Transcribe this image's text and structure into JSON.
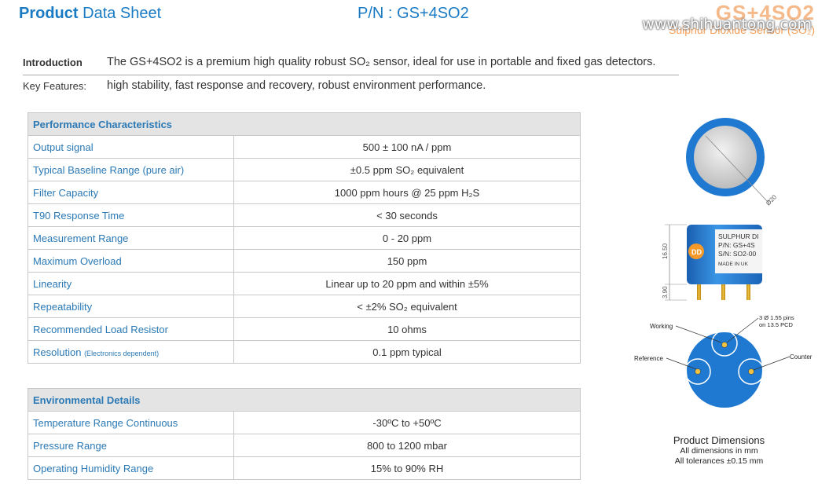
{
  "header": {
    "title_bold": "Product",
    "title_rest": "Data Sheet",
    "part_number": "P/N : GS+4SO2",
    "brand_model": "GS+4SO2",
    "brand_subtitle": "Sulphur Dioxide Sensor (SO₂)",
    "watermark": "www.shihuantong.com"
  },
  "intro": {
    "label": "Introduction",
    "text": "The GS+4SO2 is a premium high quality robust SO₂ sensor, ideal for use in portable and fixed gas detectors."
  },
  "features": {
    "label": "Key Features:",
    "text": "high stability, fast response and recovery, robust environment performance."
  },
  "performance": {
    "heading": "Performance Characteristics",
    "rows": [
      {
        "key": "Output signal",
        "value": "500 ± 100 nA / ppm"
      },
      {
        "key": "Typical Baseline Range (pure air)",
        "value": "±0.5 ppm SO₂ equivalent"
      },
      {
        "key": "Filter Capacity",
        "value": "1000 ppm hours @ 25 ppm H₂S"
      },
      {
        "key": "T90 Response Time",
        "value": "< 30 seconds"
      },
      {
        "key": "Measurement Range",
        "value": "0 - 20 ppm"
      },
      {
        "key": "Maximum Overload",
        "value": "150 ppm"
      },
      {
        "key": "Linearity",
        "value": "Linear up to 20 ppm and within ±5%"
      },
      {
        "key": "Repeatability",
        "value": "< ±2% SO₂ equivalent"
      },
      {
        "key": "Recommended Load Resistor",
        "value": "10 ohms"
      },
      {
        "key": "Resolution",
        "note": "(Electronics dependent)",
        "value": "0.1 ppm typical"
      }
    ]
  },
  "environmental": {
    "heading": "Environmental Details",
    "rows": [
      {
        "key": "Temperature Range Continuous",
        "value": "-30ºC to +50ºC"
      },
      {
        "key": "Pressure Range",
        "value": "800 to 1200 mbar"
      },
      {
        "key": "Operating Humidity Range",
        "value": "15% to 90% RH"
      }
    ]
  },
  "drawing": {
    "diameter": "Ø20",
    "side_label_line1": "SULPHUR DI",
    "side_label_line2": "P/N:  GS+4S",
    "side_label_line3": "S/N:  SO2-00",
    "side_label_line4": "MADE IN UK",
    "height_body": "16.50",
    "height_pins": "3.90",
    "pins_note_1": "3 Ø 1.55 pins",
    "pins_note_2": "on 13.5 PCD",
    "pin_working": "Working",
    "pin_reference": "Reference",
    "pin_counter": "Counter"
  },
  "dimensions": {
    "title": "Product Dimensions",
    "line1": "All dimensions in mm",
    "line2": "All tolerances ±0.15 mm"
  },
  "colors": {
    "accent_blue": "#1a7bc4",
    "sensor_blue": "#1f79d0",
    "brand_orange": "#f5a05a"
  }
}
